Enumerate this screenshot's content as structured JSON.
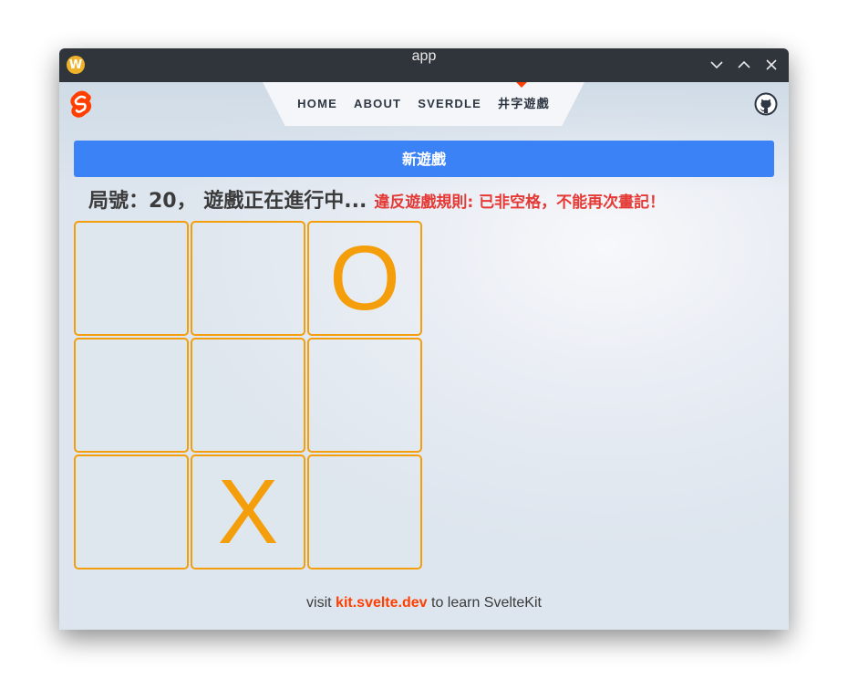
{
  "window": {
    "title": "app",
    "app_icon_letter": "W"
  },
  "nav": {
    "items": [
      "HOME",
      "ABOUT",
      "SVERDLE",
      "井字遊戲"
    ],
    "active": "井字遊戲",
    "accent_color": "#ff3e00"
  },
  "game": {
    "new_game_label": "新遊戲",
    "status": "局號：20， 遊戲正在進行中...",
    "error": "違反遊戲規則: 已非空格，不能再次畫記！",
    "board": [
      "",
      "",
      "O",
      "",
      "",
      "",
      "",
      "X",
      ""
    ],
    "mark_color": "#f59e0b",
    "button_color": "#3b82f6"
  },
  "footer": {
    "prefix": "visit ",
    "link_text": "kit.svelte.dev",
    "suffix": " to learn SvelteKit"
  }
}
